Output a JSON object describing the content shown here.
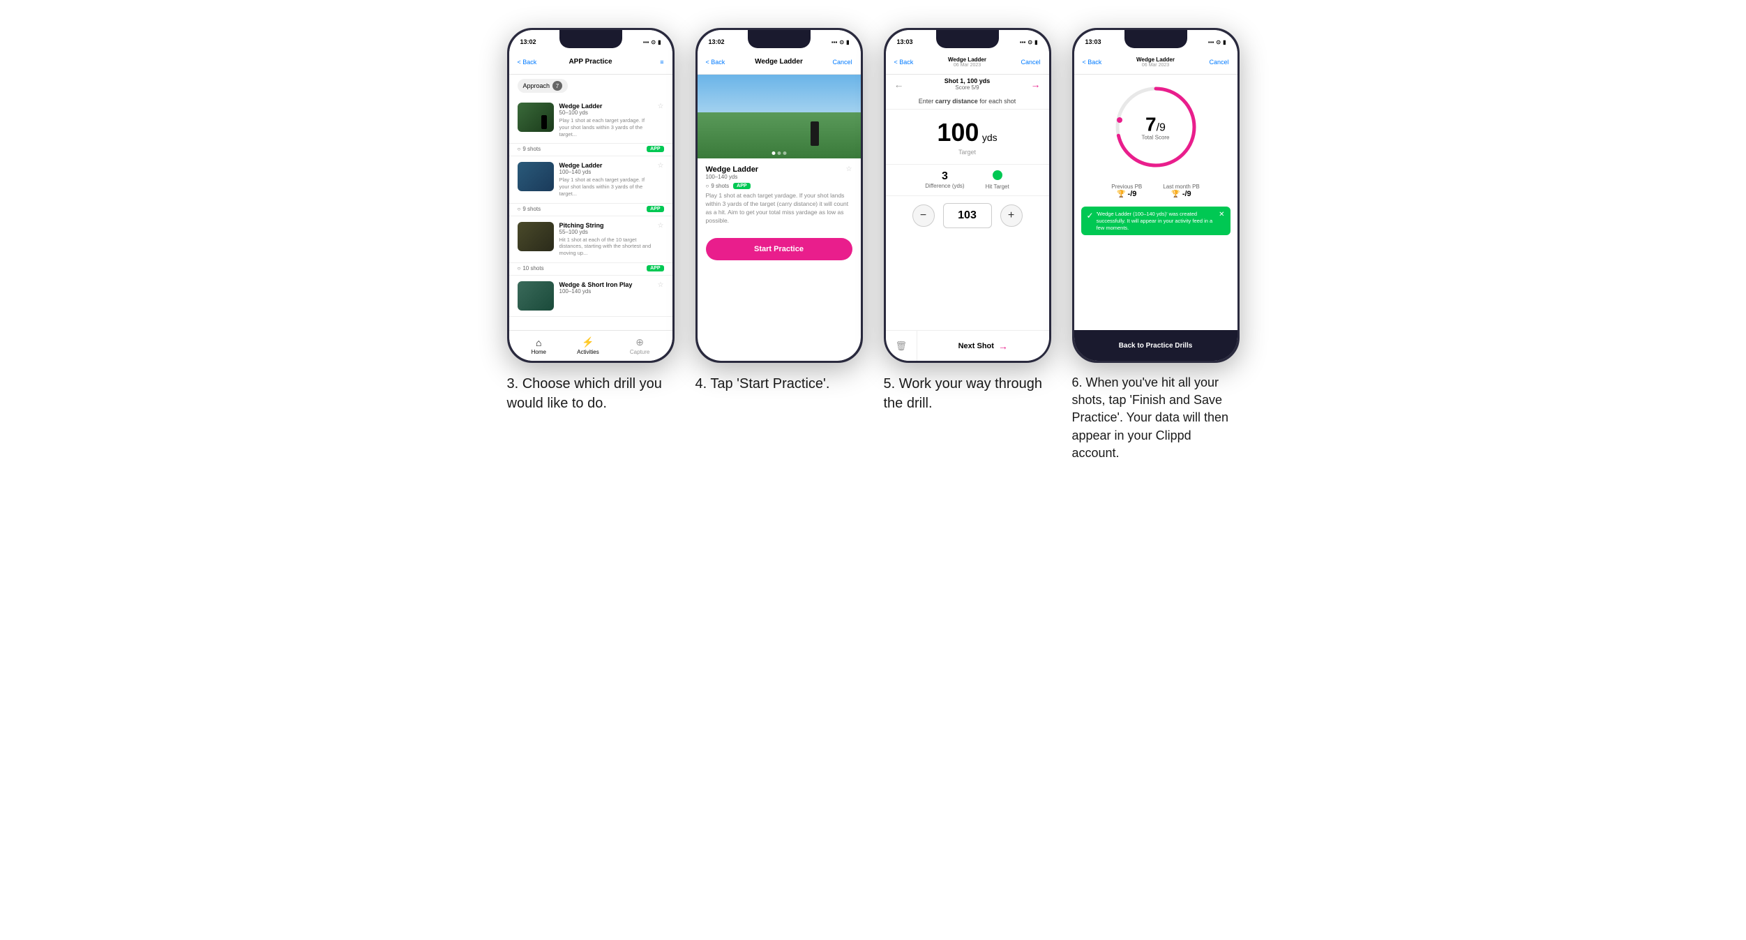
{
  "phones": [
    {
      "id": "phone1",
      "status_time": "13:02",
      "nav_back": "< Back",
      "nav_title": "APP Practice",
      "nav_menu": "≡",
      "category": "Approach",
      "category_count": "7",
      "drills": [
        {
          "title": "Wedge Ladder",
          "yds": "50–100 yds",
          "desc": "Play 1 shot at each target yardage. If your shot lands within 3 yards of the target...",
          "shots": "9 shots",
          "badge": "APP"
        },
        {
          "title": "Wedge Ladder",
          "yds": "100–140 yds",
          "desc": "Play 1 shot at each target yardage. If your shot lands within 3 yards of the target...",
          "shots": "9 shots",
          "badge": "APP"
        },
        {
          "title": "Pitching String",
          "yds": "55–100 yds",
          "desc": "Hit 1 shot at each of the 10 target distances, starting with the shortest and moving up...",
          "shots": "10 shots",
          "badge": "APP"
        },
        {
          "title": "Wedge & Short Iron Play",
          "yds": "100–140 yds",
          "desc": "",
          "shots": "",
          "badge": ""
        }
      ],
      "tabs": [
        "Home",
        "Activities",
        "Capture"
      ],
      "tab_active": 1
    },
    {
      "id": "phone2",
      "status_time": "13:02",
      "nav_back": "< Back",
      "nav_title": "Wedge Ladder",
      "nav_cancel": "Cancel",
      "drill_title": "Wedge Ladder",
      "drill_yds": "100–140 yds",
      "drill_shots": "9 shots",
      "drill_badge": "APP",
      "drill_desc": "Play 1 shot at each target yardage. If your shot lands within 3 yards of the target (carry distance) it will count as a hit. Aim to get your total miss yardage as low as possible.",
      "start_btn": "Start Practice"
    },
    {
      "id": "phone3",
      "status_time": "13:03",
      "nav_back": "< Back",
      "nav_title_line1": "Wedge Ladder",
      "nav_title_line2": "06 Mar 2023",
      "nav_cancel": "Cancel",
      "shot_label": "Shot 1, 100 yds",
      "score_label": "Score 5/9",
      "carry_instruction": "Enter carry distance for each shot",
      "target_yds": "100",
      "target_unit": "yds",
      "target_label": "Target",
      "difference": "3",
      "difference_label": "Difference (yds)",
      "hit_target_label": "Hit Target",
      "input_value": "103",
      "next_shot": "Next Shot"
    },
    {
      "id": "phone4",
      "status_time": "13:03",
      "nav_back": "< Back",
      "nav_title_line1": "Wedge Ladder",
      "nav_title_line2": "06 Mar 2023",
      "nav_cancel": "Cancel",
      "score_numerator": "7",
      "score_denominator": "/9",
      "score_label": "Total Score",
      "prev_pb_label": "Previous PB",
      "prev_pb_val": "-/9",
      "last_pb_label": "Last month PB",
      "last_pb_val": "-/9",
      "success_msg": "'Wedge Ladder (100–140 yds)' was created successfully. It will appear in your activity feed in a few moments.",
      "back_btn": "Back to Practice Drills"
    }
  ],
  "captions": [
    "3. Choose which drill you would like to do.",
    "4. Tap 'Start Practice'.",
    "5. Work your way through the drill.",
    "6. When you've hit all your shots, tap 'Finish and Save Practice'. Your data will then appear in your Clippd account."
  ]
}
